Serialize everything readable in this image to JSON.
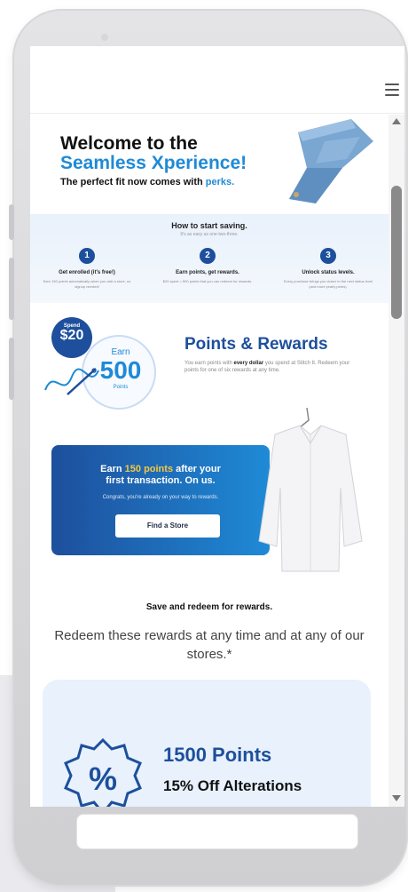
{
  "hero": {
    "line1": "Welcome to the",
    "line2": "Seamless Xperience!",
    "sub_prefix": "The perfect fit now comes with ",
    "sub_highlight": "perks."
  },
  "steps": {
    "heading": "How to start saving.",
    "tagline": "It's as easy as one-two-three.",
    "items": [
      {
        "num": "1",
        "title": "Get enrolled (it's free!)",
        "desc": "Earn 150 points automatically when you visit a store, no signup needed!"
      },
      {
        "num": "2",
        "title": "Earn points, get rewards.",
        "desc": "$20 spent = 500 points that you can redeem for rewards."
      },
      {
        "num": "3",
        "title": "Unlock status levels.",
        "desc": "Every purchase brings you closer to the next status level (and more yearly perks)."
      }
    ]
  },
  "badge": {
    "spend_label": "Spend",
    "spend_value": "$20",
    "earn_label": "Earn",
    "earn_value": "500",
    "points_label": "Points"
  },
  "points_rewards": {
    "title": "Points & Rewards",
    "desc_prefix": "You earn points with ",
    "desc_bold": "every dollar",
    "desc_suffix": " you spend at Stitch It. Redeem your points for one of six rewards at any time."
  },
  "promo": {
    "line1_prefix": "Earn ",
    "line1_highlight": "150 points",
    "line1_suffix": " after your",
    "line2": "first transaction. On us.",
    "line3": "Congrats, you're already on your way to rewards.",
    "button_label": "Find a Store"
  },
  "save": {
    "title": "Save and redeem for rewards.",
    "text": "Redeem these rewards at any time and at any of our stores.*"
  },
  "reward": {
    "points": "1500 Points",
    "label": "15% Off Alterations"
  },
  "colors": {
    "brand_blue": "#1d4f9c",
    "accent_blue": "#1f8ad6",
    "highlight_yellow": "#f5c842"
  }
}
